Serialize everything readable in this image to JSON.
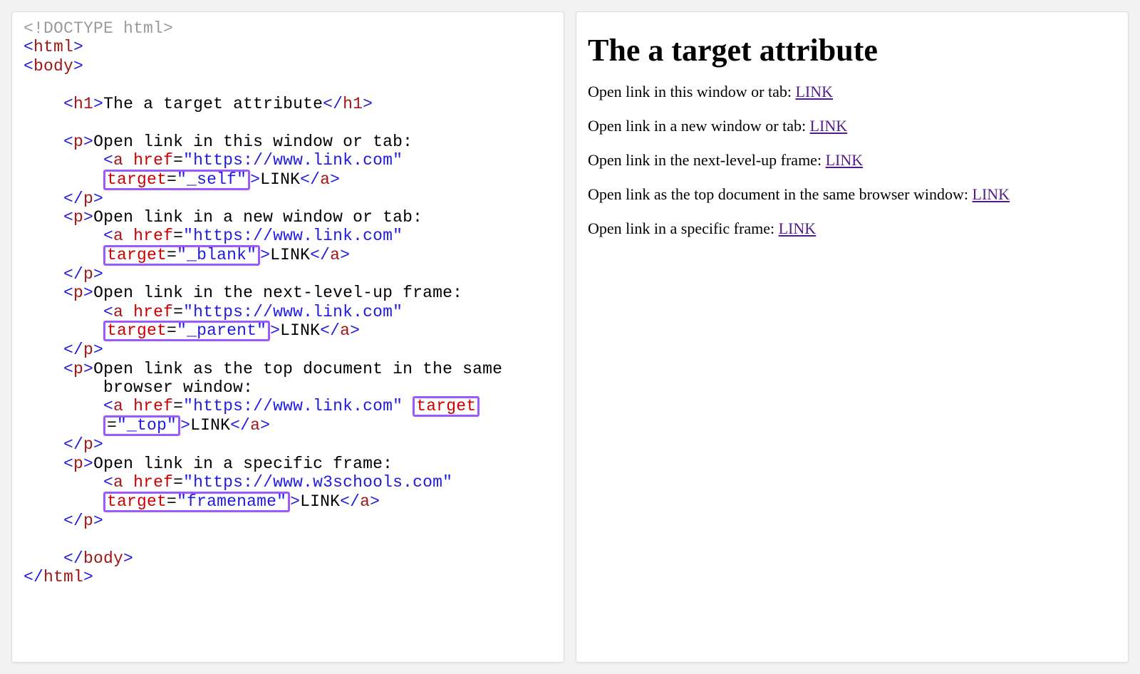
{
  "code": {
    "doctype": "<!DOCTYPE html>",
    "html_open": "html",
    "body_open": "body",
    "h1_tag_open": "h1",
    "h1_text": "The a target attribute",
    "h1_tag_close": "h1",
    "p_tag": "p",
    "a_tag_open": "a",
    "a_tag_close": "a",
    "href_attr": "href",
    "target_attr": "target",
    "url_main": "\"https://www.link.com\"",
    "url_frame": "\"https://www.w3schools.com\"",
    "target_self": "\"_self\"",
    "target_blank": "\"_blank\"",
    "target_parent": "\"_parent\"",
    "target_top_eq": "=",
    "target_top_val": "\"_top\"",
    "target_framename": "\"framename\"",
    "linktext": "LINK",
    "p1_text": "Open link in this window or tab:",
    "p2_text": "Open link in a new window or tab:",
    "p3_text": "Open link in the next-level-up frame:",
    "p4_text_a": "Open link as the top document in the same",
    "p4_text_b": "browser window:",
    "p5_text": "Open link in a specific frame:",
    "body_close": "body",
    "html_close": "html"
  },
  "preview": {
    "heading": "The a target attribute",
    "items": [
      {
        "text": "Open link in this window or tab: ",
        "link": "LINK"
      },
      {
        "text": "Open link in a new window or tab: ",
        "link": "LINK"
      },
      {
        "text": "Open link in the next-level-up frame: ",
        "link": "LINK"
      },
      {
        "text": "Open link as the top document in the same browser window: ",
        "link": "LINK"
      },
      {
        "text": "Open link in a specific frame: ",
        "link": "LINK"
      }
    ]
  }
}
